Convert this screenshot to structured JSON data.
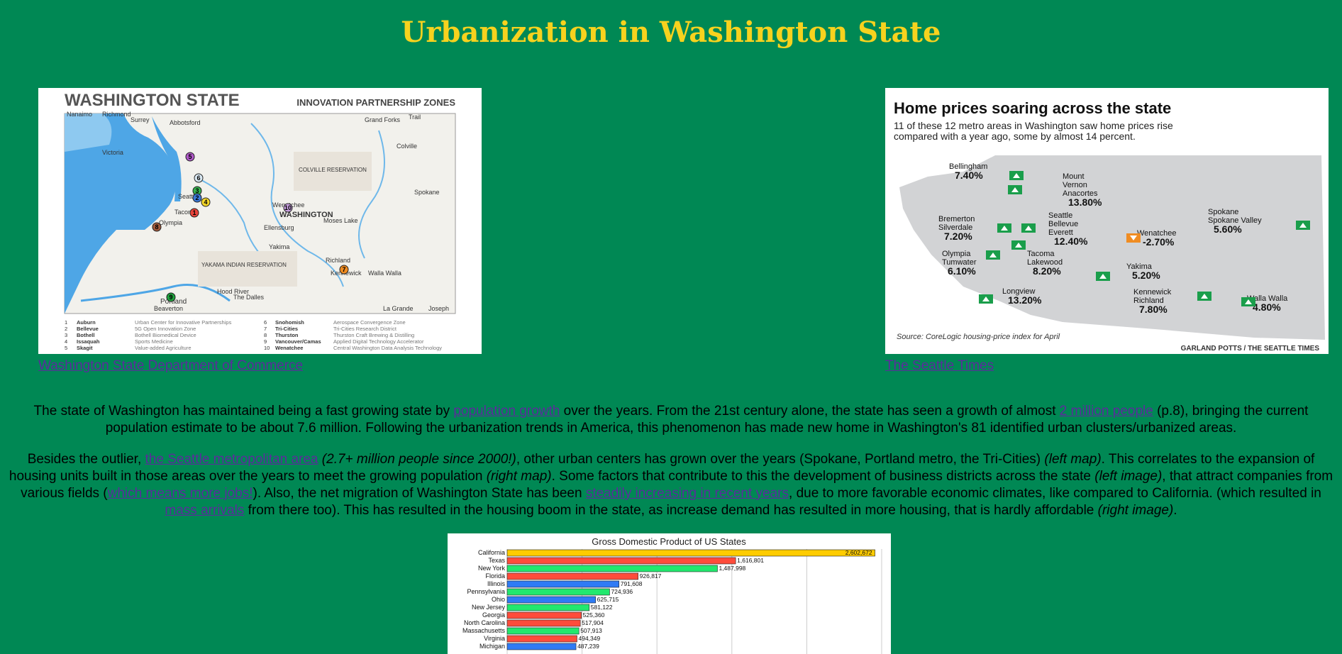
{
  "page": {
    "title": "Urbanization in Washington State"
  },
  "left_figure": {
    "heading": "WASHINGTON STATE",
    "subheading": "INNOVATION PARTNERSHIP ZONES",
    "map_labels": {
      "nanaimo": "Nanaimo",
      "richmond": "Richmond",
      "surrey": "Surrey",
      "abbotsford": "Abbotsford",
      "grand_forks": "Grand Forks",
      "trail": "Trail",
      "victoria": "Victoria",
      "colville": "Colville",
      "colville_res": "COLVILLE RESERVATION",
      "spokane": "Spokane",
      "wenatchee": "Wenatchee",
      "washington": "WASHINGTON",
      "ellensburg": "Ellensburg",
      "moses_lake": "Moses Lake",
      "yakima": "Yakima",
      "yakama_res": "YAKAMA INDIAN RESERVATION",
      "richland": "Richland",
      "kennewick": "Kennewick",
      "walla_walla": "Walla Walla",
      "hood_river": "Hood River",
      "the_dalles": "The Dalles",
      "portland": "Portland",
      "beaverton": "Beaverton",
      "la_grande": "La Grande",
      "joseph": "Joseph",
      "seattle": "Seattle",
      "tacoma": "Tacoma",
      "olympia": "Olympia"
    },
    "legend_left": [
      {
        "n": "1",
        "city": "Auburn",
        "zone": "Urban Center for Innovative Partnerships"
      },
      {
        "n": "2",
        "city": "Bellevue",
        "zone": "5G Open Innovation Zone"
      },
      {
        "n": "3",
        "city": "Bothell",
        "zone": "Bothell Biomedical Device"
      },
      {
        "n": "4",
        "city": "Issaquah",
        "zone": "Sports Medicine"
      },
      {
        "n": "5",
        "city": "Skagit",
        "zone": "Value-added Agriculture"
      }
    ],
    "legend_right": [
      {
        "n": "6",
        "city": "Snohomish",
        "zone": "Aerospace Convergence Zone"
      },
      {
        "n": "7",
        "city": "Tri-Cities",
        "zone": "Tri-Cities Research District"
      },
      {
        "n": "8",
        "city": "Thurston",
        "zone": "Thurston Craft Brewing & Distilling"
      },
      {
        "n": "9",
        "city": "Vancouver/Camas",
        "zone": "Applied Digital Technology Accelerator"
      },
      {
        "n": "10",
        "city": "Wenatchee",
        "zone": "Central Washington Data Analysis Technology"
      }
    ],
    "markers": [
      {
        "n": "1",
        "color": "#e8433a"
      },
      {
        "n": "2",
        "color": "#3a78d6"
      },
      {
        "n": "3",
        "color": "#37b24d"
      },
      {
        "n": "4",
        "color": "#f5d728"
      },
      {
        "n": "5",
        "color": "#b058c9"
      },
      {
        "n": "6",
        "color": "#d9e8f2"
      },
      {
        "n": "7",
        "color": "#f08c22"
      },
      {
        "n": "8",
        "color": "#a35a3b"
      },
      {
        "n": "9",
        "color": "#1fa13c"
      },
      {
        "n": "10",
        "color": "#c9a0e0"
      }
    ],
    "caption": "Washington State Department of Commerce"
  },
  "right_figure": {
    "heading": "Home prices soaring across the state",
    "subheading_line1": "11 of these 12 metro areas in Washington saw home prices rise",
    "subheading_line2": "compared with a year ago, some by almost 14 percent.",
    "areas": [
      {
        "name": "Bellingham",
        "value": "7.40%",
        "trend": "up"
      },
      {
        "name": "Mount Vernon Anacortes",
        "value": "13.80%",
        "trend": "up"
      },
      {
        "name": "Bremerton Silverdale",
        "value": "7.20%",
        "trend": "up"
      },
      {
        "name": "Seattle Bellevue Everett",
        "value": "12.40%",
        "trend": "up"
      },
      {
        "name": "Wenatchee",
        "value": "-2.70%",
        "trend": "down"
      },
      {
        "name": "Spokane Spokane Valley",
        "value": "5.60%",
        "trend": "up"
      },
      {
        "name": "Olympia Tumwater",
        "value": "6.10%",
        "trend": "up"
      },
      {
        "name": "Tacoma Lakewood",
        "value": "8.20%",
        "trend": "up"
      },
      {
        "name": "Yakima",
        "value": "5.20%",
        "trend": "up"
      },
      {
        "name": "Longview",
        "value": "13.20%",
        "trend": "up"
      },
      {
        "name": "Kennewick Richland",
        "value": "7.80%",
        "trend": "up"
      },
      {
        "name": "Walla Walla",
        "value": "4.80%",
        "trend": "up"
      }
    ],
    "source": "Source: CoreLogic housing-price index for April",
    "credit": "GARLAND POTTS / THE SEATTLE TIMES",
    "colors": {
      "up": "#1a9e4b",
      "down": "#f08c22"
    },
    "caption": "The Seattle Times"
  },
  "paragraph1": {
    "t1": "The state of Washington has maintained being a fast growing state by ",
    "link1": "population growth",
    "t2": " over the years. From the 21st century alone, the state has seen a growth of almost ",
    "link2": "2 million people",
    "t3": " (p.8), bringing the current population estimate to be about 7.6 million. Following the urbanization trends in America, this phenomenon has made new home in Washington's 81 identified urban clusters/urbanized areas."
  },
  "paragraph2": {
    "t1": "Besides the outlier, ",
    "link1": "the Seattle metropolitan area",
    "em1": " (2.7+ million people since 2000!)",
    "t2": ", other urban centers has grown over the years (Spokane, Portland metro, the Tri-Cities) ",
    "em2": "(left map)",
    "t3": ". This correlates to the expansion of housing units built in those areas over the years to meet the growing population ",
    "em3": "(right map)",
    "t4": ". Some factors that contribute to this the development of business districts across the state ",
    "em4": "(left image)",
    "t5": ", that attract companies from various fields (",
    "link2": "which means more jobs!",
    "t6": "). Also, the net migration of Washington State has been ",
    "link3": "steadily increasing in recent years",
    "t7": ", due to more favorable economic climates, like compared to California. (which resulted in ",
    "link4": "mass arrivals",
    "t8": " from there too). This has resulted in the housing boom in the state, as increase demand has resulted in more housing, that is hardly affordable ",
    "em5": "(right image)",
    "t9": "."
  },
  "chart_data": {
    "type": "bar",
    "orientation": "horizontal",
    "title": "Gross Domestic Product of US States",
    "categories": [
      "California",
      "Texas",
      "New York",
      "Florida",
      "Illinois",
      "Pennsylvania",
      "Ohio",
      "New Jersey",
      "Georgia",
      "North Carolina",
      "Massachusetts",
      "Virginia",
      "Michigan"
    ],
    "values": [
      2602672,
      1616801,
      1487998,
      926817,
      791608,
      724936,
      625715,
      581122,
      525360,
      517904,
      507913,
      494349,
      487239
    ],
    "labels": [
      "2,602,672",
      "1,616,801",
      "1,487,998",
      "926,817",
      "791,608",
      "724,936",
      "625,715",
      "581,122",
      "525,360",
      "517,904",
      "507,913",
      "494,349",
      "487,239"
    ],
    "colors": [
      "#ffcc00",
      "#ff4c3b",
      "#22e86e",
      "#ff4c3b",
      "#2f7bf5",
      "#22e86e",
      "#2f7bf5",
      "#22e86e",
      "#ff4c3b",
      "#ff4c3b",
      "#22e86e",
      "#ff4c3b",
      "#2f7bf5"
    ],
    "xlim": [
      0,
      2650000
    ],
    "grid": true
  }
}
